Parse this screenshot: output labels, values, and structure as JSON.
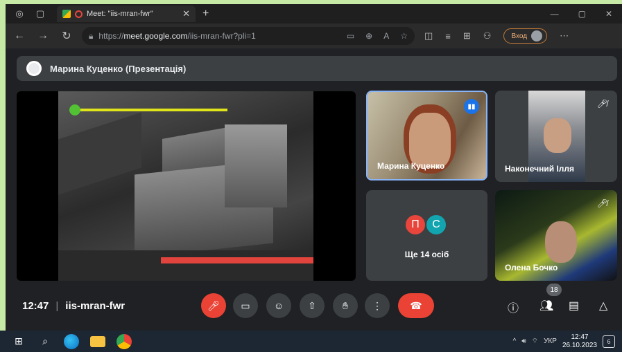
{
  "browser": {
    "tab_title": "Meet: \"iis-mran-fwr\"",
    "url_prefix": "https://",
    "url_host": "meet.google.com",
    "url_path": "/iis-mran-fwr?pli=1",
    "signin_label": "Вход"
  },
  "meet": {
    "presenter_banner": "Марина Куценко (Презентація)",
    "participants": [
      {
        "name": "Марина Куценко",
        "speaking": true
      },
      {
        "name": "Наконечний Ілля",
        "muted": true
      },
      {
        "name": "Олена Бочко",
        "muted": true
      }
    ],
    "others": {
      "avatar_1": "П",
      "avatar_2": "С",
      "label": "Ще 14 осіб"
    },
    "colors": {
      "accent": "#8ab4f8",
      "danger": "#ea4335"
    }
  },
  "controls": {
    "time": "12:47",
    "meeting_code": "iis-mran-fwr",
    "people_count": "18"
  },
  "taskbar": {
    "language": "УКР",
    "clock_time": "12:47",
    "clock_date": "26.10.2023",
    "notification_count": "6"
  }
}
